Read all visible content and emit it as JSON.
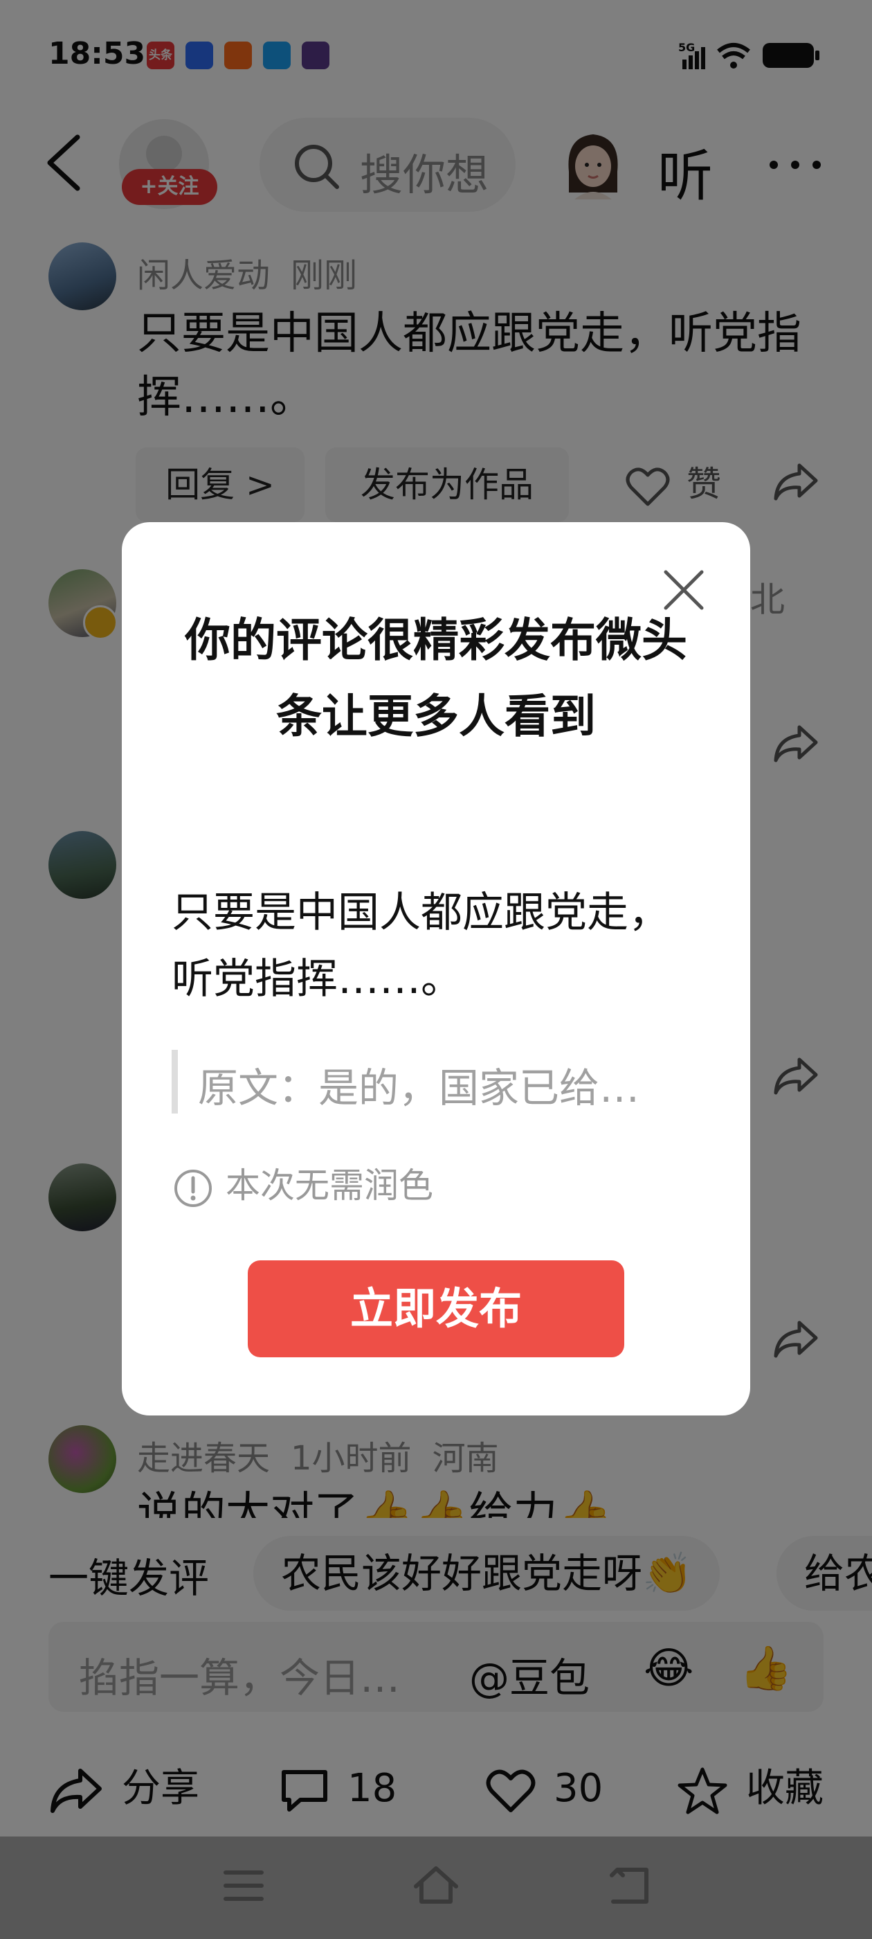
{
  "status_bar": {
    "time": "18:53",
    "network": "5G",
    "app_icons": [
      "toutiao-app-icon",
      "baidu-app-icon",
      "kuaishou-app-icon",
      "app-icon",
      "game-app-icon"
    ],
    "toutiao_icon_text": "头条"
  },
  "header": {
    "follow_label": "+关注",
    "search_placeholder": "搜你想",
    "listen_label": "听"
  },
  "comments": [
    {
      "user": "闲人爱动",
      "time": "刚刚",
      "text": "只要是中国人都应跟党走，听党指挥……。",
      "reply_label": "回复 >",
      "publish_label": "发布为作品",
      "like_label": "赞"
    },
    {
      "location_fragment": "北"
    },
    {},
    {},
    {
      "user": "走进春天",
      "time": "1小时前",
      "location": "河南",
      "text": "说的太对了👍👍给力👍"
    }
  ],
  "quick_reply": {
    "label": "一键发评",
    "chips": [
      "农民该好好跟党走呀👏",
      "给农"
    ]
  },
  "input": {
    "placeholder": "掐指一算，今日…",
    "mention": "@豆包",
    "emojis": [
      "😂",
      "👍"
    ]
  },
  "bottom_bar": {
    "share_label": "分享",
    "comments_count": "18",
    "likes_count": "30",
    "favorite_label": "收藏"
  },
  "dialog": {
    "title": "你的评论很精彩发布微头条让更多人看到",
    "comment_text": "只要是中国人都应跟党走，听党指挥……。",
    "quote": "原文：是的，国家已给…",
    "note": "本次无需润色",
    "publish_button": "立即发布"
  },
  "colors": {
    "accent_red": "#ee4f47",
    "follow_red": "#e8393b",
    "overlay": "rgba(0,0,0,0.5)"
  }
}
